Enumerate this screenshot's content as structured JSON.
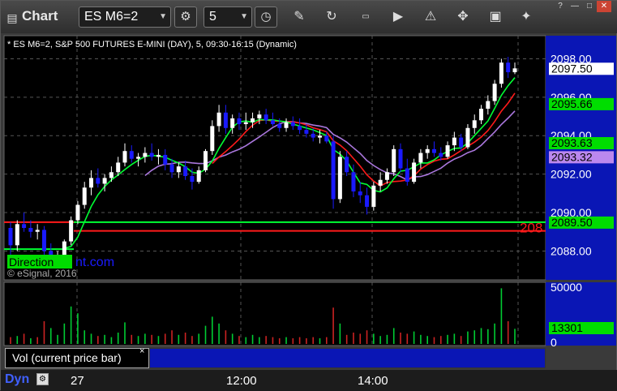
{
  "app": {
    "title": "Chart"
  },
  "toolbar": {
    "symbol": "ES M6=2",
    "interval": "5"
  },
  "chart_header": "* ES M6=2, S&P 500 FUTURES E-MINI (DAY), 5, 09:30-16:15 (Dynamic)",
  "watermark": {
    "site": "DirectionalTrader.com",
    "visible_left": "Direction",
    "visible_right": "nt.com",
    "copyright": "© eSignal, 2016"
  },
  "price_axis": {
    "ticks": [
      "2098.00",
      "2096.00",
      "2094.00",
      "2092.00",
      "2090.00",
      "2088.00"
    ],
    "labels": [
      {
        "text": "2097.50",
        "bg": "#ffffff",
        "fg": "#000000"
      },
      {
        "text": "2095.66",
        "bg": "#00dd00",
        "fg": "#000000"
      },
      {
        "text": "2093.63",
        "bg": "#00dd00",
        "fg": "#000000"
      },
      {
        "text": "2093.32",
        "bg": "#bb88ee",
        "fg": "#000000"
      },
      {
        "text": "2089.50",
        "bg": "#00dd00",
        "fg": "#000000"
      }
    ],
    "red_line_label": "208"
  },
  "volume_axis": {
    "ticks": [
      "50000",
      "0"
    ],
    "current_label": "13301",
    "panel_label": "Vol (current price bar)",
    "close": "×"
  },
  "time_axis": {
    "ticks": [
      "27",
      "12:00",
      "14:00"
    ]
  },
  "footer": {
    "dyn": "Dyn"
  },
  "colors": {
    "up": "#ffffff",
    "down": "#1a1aff",
    "ma_fast": "#00ff33",
    "ma_red": "#ff1a1a",
    "ma_purple": "#aa77dd",
    "level_green": "#00ff33",
    "level_red": "#ff1a1a",
    "vol_up": "#00cc33",
    "vol_down": "#cc2222"
  },
  "chart_data": {
    "type": "candlestick",
    "ylim": [
      2086.5,
      2099.2
    ],
    "volume_ylim": [
      0,
      50000
    ],
    "horizontal_levels": [
      {
        "name": "green level",
        "value": 2089.5
      },
      {
        "name": "red level",
        "value": 2089.3
      }
    ],
    "candles": [
      [
        2089.2,
        2089.5,
        2087.6,
        2088.3
      ],
      [
        2088.3,
        2089.6,
        2088.0,
        2089.4
      ],
      [
        2089.4,
        2090.0,
        2089.0,
        2089.2
      ],
      [
        2089.2,
        2089.6,
        2088.7,
        2089.0
      ],
      [
        2089.0,
        2089.4,
        2088.6,
        2089.1
      ],
      [
        2089.1,
        2089.3,
        2087.8,
        2088.0
      ],
      [
        2088.0,
        2088.4,
        2087.2,
        2087.3
      ],
      [
        2087.3,
        2088.0,
        2087.1,
        2087.8
      ],
      [
        2087.8,
        2088.6,
        2087.6,
        2088.5
      ],
      [
        2088.5,
        2089.8,
        2088.3,
        2089.6
      ],
      [
        2089.6,
        2090.6,
        2089.4,
        2090.4
      ],
      [
        2090.4,
        2091.6,
        2090.2,
        2091.3
      ],
      [
        2091.3,
        2092.2,
        2090.9,
        2091.8
      ],
      [
        2091.8,
        2092.3,
        2091.3,
        2091.5
      ],
      [
        2091.5,
        2092.0,
        2091.1,
        2091.8
      ],
      [
        2091.8,
        2092.4,
        2091.6,
        2092.1
      ],
      [
        2092.1,
        2092.9,
        2091.9,
        2092.6
      ],
      [
        2092.6,
        2093.6,
        2092.4,
        2093.2
      ],
      [
        2093.2,
        2093.5,
        2092.6,
        2092.8
      ],
      [
        2092.8,
        2093.1,
        2092.4,
        2092.9
      ],
      [
        2092.9,
        2093.4,
        2092.6,
        2093.1
      ],
      [
        2093.1,
        2093.6,
        2092.7,
        2092.9
      ],
      [
        2092.9,
        2093.3,
        2092.5,
        2093.0
      ],
      [
        2093.0,
        2093.3,
        2092.2,
        2092.5
      ],
      [
        2092.5,
        2092.8,
        2091.8,
        2092.1
      ],
      [
        2092.1,
        2092.6,
        2091.8,
        2092.4
      ],
      [
        2092.4,
        2092.7,
        2091.7,
        2091.9
      ],
      [
        2091.9,
        2092.3,
        2091.2,
        2091.6
      ],
      [
        2091.6,
        2092.4,
        2091.5,
        2092.2
      ],
      [
        2092.2,
        2093.3,
        2092.1,
        2093.2
      ],
      [
        2093.2,
        2094.8,
        2093.0,
        2094.5
      ],
      [
        2094.5,
        2095.6,
        2094.2,
        2095.2
      ],
      [
        2095.2,
        2095.6,
        2094.1,
        2094.4
      ],
      [
        2094.4,
        2095.1,
        2094.1,
        2094.9
      ],
      [
        2094.9,
        2095.2,
        2094.3,
        2094.6
      ],
      [
        2094.6,
        2095.2,
        2094.3,
        2094.7
      ],
      [
        2094.7,
        2095.2,
        2094.4,
        2094.9
      ],
      [
        2094.9,
        2095.3,
        2094.6,
        2095.1
      ],
      [
        2095.1,
        2095.4,
        2094.6,
        2094.8
      ],
      [
        2094.8,
        2095.2,
        2094.5,
        2094.6
      ],
      [
        2094.6,
        2094.9,
        2094.2,
        2094.4
      ],
      [
        2094.4,
        2094.9,
        2094.2,
        2094.7
      ],
      [
        2094.7,
        2095.0,
        2094.3,
        2094.5
      ],
      [
        2094.5,
        2094.9,
        2094.1,
        2094.3
      ],
      [
        2094.3,
        2094.6,
        2093.9,
        2094.1
      ],
      [
        2094.1,
        2094.4,
        2093.7,
        2093.9
      ],
      [
        2093.9,
        2094.3,
        2093.6,
        2094.0
      ],
      [
        2094.0,
        2094.2,
        2093.6,
        2093.7
      ],
      [
        2093.7,
        2094.0,
        2090.2,
        2090.7
      ],
      [
        2090.7,
        2093.2,
        2090.5,
        2092.9
      ],
      [
        2092.9,
        2093.2,
        2091.9,
        2092.1
      ],
      [
        2092.1,
        2092.5,
        2090.8,
        2091.1
      ],
      [
        2091.1,
        2091.6,
        2090.5,
        2090.9
      ],
      [
        2090.9,
        2091.3,
        2089.9,
        2090.3
      ],
      [
        2090.3,
        2091.6,
        2090.1,
        2091.4
      ],
      [
        2091.4,
        2092.1,
        2091.1,
        2091.7
      ],
      [
        2091.7,
        2092.3,
        2091.5,
        2092.1
      ],
      [
        2092.1,
        2093.5,
        2091.9,
        2093.3
      ],
      [
        2093.3,
        2093.6,
        2092.1,
        2092.3
      ],
      [
        2092.3,
        2092.8,
        2091.4,
        2091.6
      ],
      [
        2091.6,
        2092.8,
        2091.5,
        2092.6
      ],
      [
        2092.6,
        2093.3,
        2092.3,
        2093.1
      ],
      [
        2093.1,
        2093.5,
        2092.8,
        2093.3
      ],
      [
        2093.3,
        2093.7,
        2092.9,
        2093.1
      ],
      [
        2093.1,
        2093.4,
        2092.7,
        2092.9
      ],
      [
        2092.9,
        2093.7,
        2092.8,
        2093.5
      ],
      [
        2093.5,
        2094.2,
        2093.2,
        2093.9
      ],
      [
        2093.9,
        2094.1,
        2093.2,
        2093.4
      ],
      [
        2093.4,
        2094.6,
        2093.3,
        2094.4
      ],
      [
        2094.4,
        2095.1,
        2094.1,
        2094.8
      ],
      [
        2094.8,
        2095.6,
        2094.6,
        2095.4
      ],
      [
        2095.4,
        2096.1,
        2095.1,
        2095.8
      ],
      [
        2095.8,
        2096.9,
        2095.6,
        2096.7
      ],
      [
        2096.7,
        2098.0,
        2096.5,
        2097.8
      ],
      [
        2097.8,
        2098.1,
        2097.0,
        2097.3
      ],
      [
        2097.3,
        2097.8,
        2097.2,
        2097.5
      ]
    ],
    "volume": [
      [
        6000,
        0
      ],
      [
        7000,
        1
      ],
      [
        9000,
        0
      ],
      [
        5000,
        1
      ],
      [
        6000,
        0
      ],
      [
        20000,
        0
      ],
      [
        14000,
        1
      ],
      [
        8000,
        1
      ],
      [
        18000,
        1
      ],
      [
        33000,
        1
      ],
      [
        27000,
        1
      ],
      [
        12000,
        1
      ],
      [
        9000,
        1
      ],
      [
        7000,
        0
      ],
      [
        8000,
        1
      ],
      [
        6000,
        1
      ],
      [
        10000,
        1
      ],
      [
        19000,
        1
      ],
      [
        8000,
        0
      ],
      [
        7000,
        1
      ],
      [
        9000,
        1
      ],
      [
        8000,
        0
      ],
      [
        7000,
        1
      ],
      [
        9000,
        0
      ],
      [
        12000,
        0
      ],
      [
        8000,
        1
      ],
      [
        10000,
        0
      ],
      [
        7000,
        0
      ],
      [
        9000,
        1
      ],
      [
        16000,
        1
      ],
      [
        24000,
        1
      ],
      [
        18000,
        1
      ],
      [
        12000,
        0
      ],
      [
        9000,
        1
      ],
      [
        7000,
        0
      ],
      [
        6000,
        1
      ],
      [
        8000,
        1
      ],
      [
        6000,
        1
      ],
      [
        7000,
        0
      ],
      [
        6000,
        0
      ],
      [
        5000,
        0
      ],
      [
        6000,
        1
      ],
      [
        5000,
        0
      ],
      [
        6000,
        0
      ],
      [
        5000,
        0
      ],
      [
        6000,
        0
      ],
      [
        5000,
        1
      ],
      [
        6000,
        0
      ],
      [
        32000,
        0
      ],
      [
        18000,
        1
      ],
      [
        8000,
        0
      ],
      [
        10000,
        0
      ],
      [
        9000,
        0
      ],
      [
        12000,
        0
      ],
      [
        9000,
        1
      ],
      [
        7000,
        1
      ],
      [
        8000,
        1
      ],
      [
        14000,
        1
      ],
      [
        10000,
        0
      ],
      [
        9000,
        0
      ],
      [
        11000,
        1
      ],
      [
        8000,
        1
      ],
      [
        7000,
        1
      ],
      [
        6000,
        0
      ],
      [
        7000,
        0
      ],
      [
        8000,
        1
      ],
      [
        9000,
        1
      ],
      [
        7000,
        0
      ],
      [
        11000,
        1
      ],
      [
        12000,
        1
      ],
      [
        14000,
        1
      ],
      [
        13000,
        1
      ],
      [
        18000,
        1
      ],
      [
        49000,
        1
      ],
      [
        20000,
        0
      ],
      [
        13301,
        1
      ]
    ]
  }
}
